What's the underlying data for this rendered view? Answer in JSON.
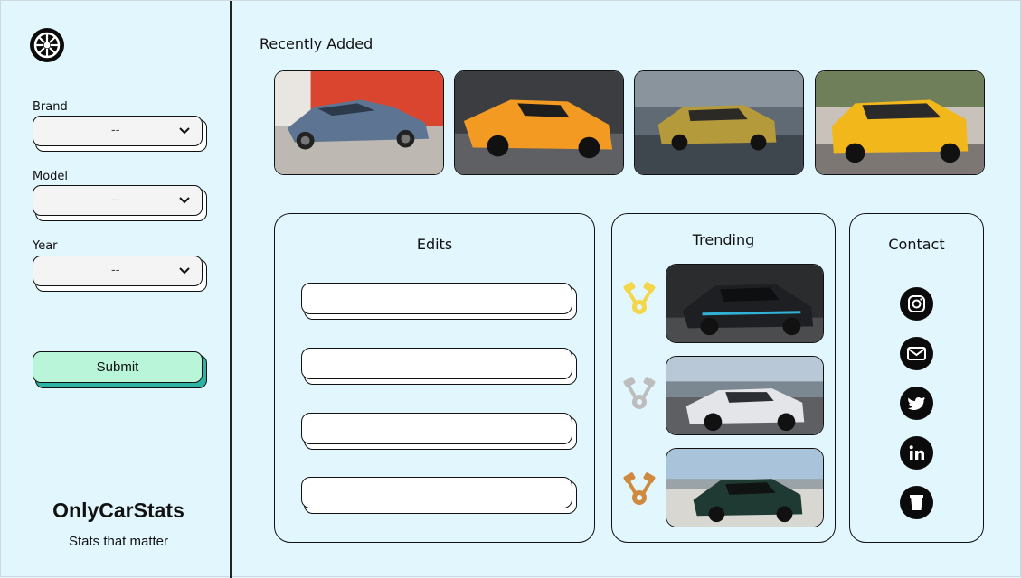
{
  "sidebar": {
    "logo_icon": "wheel-icon",
    "fields": [
      {
        "label": "Brand",
        "value": "--"
      },
      {
        "label": "Model",
        "value": "--"
      },
      {
        "label": "Year",
        "value": "--"
      }
    ],
    "submit_label": "Submit",
    "brand_name": "OnlyCarStats",
    "tagline": "Stats that matter"
  },
  "main": {
    "recently_added_title": "Recently Added",
    "recent_cars": [
      {
        "icon": "blue-coupe-photo"
      },
      {
        "icon": "orange-supercar-photo"
      },
      {
        "icon": "gold-luxury-coupe-photo"
      },
      {
        "icon": "yellow-suv-photo"
      }
    ],
    "edits": {
      "title": "Edits",
      "inputs": [
        "",
        "",
        "",
        ""
      ]
    },
    "trending": {
      "title": "Trending",
      "items": [
        {
          "medal": "gold-piston-medal-icon",
          "color": "#f3d64a",
          "photo": "black-hypercar-photo"
        },
        {
          "medal": "silver-piston-medal-icon",
          "color": "#bdbdbd",
          "photo": "white-sports-car-photo"
        },
        {
          "medal": "bronze-piston-medal-icon",
          "color": "#d08a3e",
          "photo": "green-sedan-photo"
        }
      ]
    },
    "contact": {
      "title": "Contact",
      "links": [
        {
          "icon": "instagram-icon"
        },
        {
          "icon": "mail-icon"
        },
        {
          "icon": "twitter-icon"
        },
        {
          "icon": "linkedin-icon"
        },
        {
          "icon": "cup-icon"
        }
      ]
    }
  },
  "colors": {
    "background": "#e2f6fd",
    "submit": "#b9f5d8",
    "submit_shadow": "#2bb3a6",
    "border": "#111111"
  }
}
